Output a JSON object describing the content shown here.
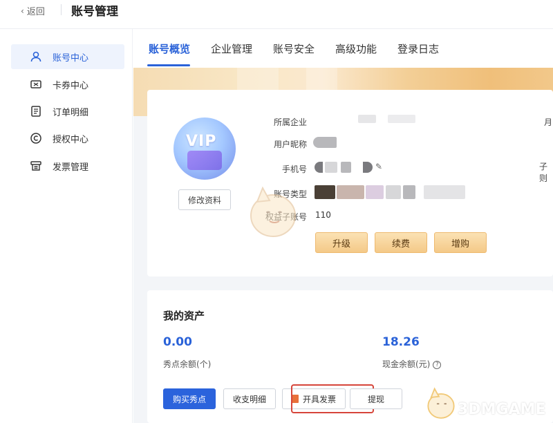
{
  "topbar": {
    "back_label": "返回",
    "title": "账号管理"
  },
  "sidebar": {
    "items": [
      {
        "label": "账号中心",
        "icon": "user-icon",
        "active": true
      },
      {
        "label": "卡券中心",
        "icon": "ticket-icon",
        "active": false
      },
      {
        "label": "订单明细",
        "icon": "document-icon",
        "active": false
      },
      {
        "label": "授权中心",
        "icon": "copyright-icon",
        "active": false
      },
      {
        "label": "发票管理",
        "icon": "invoice-icon",
        "active": false
      }
    ]
  },
  "tabs": [
    {
      "label": "账号概览",
      "active": true
    },
    {
      "label": "企业管理",
      "active": false
    },
    {
      "label": "账号安全",
      "active": false
    },
    {
      "label": "高级功能",
      "active": false
    },
    {
      "label": "登录日志",
      "active": false
    }
  ],
  "profile": {
    "badge_text": "VIP",
    "edit_label": "修改资料",
    "fields": {
      "company_label": "所属企业",
      "nickname_label": "用户昵称",
      "phone_label": "手机号",
      "account_type_label": "账号类型",
      "sub_accounts_label": "权益子账号",
      "sub_accounts_value": "110"
    },
    "right_cut_labels": [
      "月",
      "子则"
    ],
    "actions": {
      "upgrade": "升级",
      "renew": "续费",
      "add": "增购"
    }
  },
  "assets": {
    "title": "我的资产",
    "points_value": "0.00",
    "points_label": "秀点余额(个)",
    "cash_value": "18.26",
    "cash_label": "现金余额(元)",
    "buttons": {
      "buy_points": "购买秀点",
      "statement": "收支明细",
      "invoice": "开具发票",
      "withdraw": "提现"
    }
  },
  "watermark": {
    "text": "3DMGAME"
  },
  "colors": {
    "accent": "#2a62d8",
    "highlight_border": "#d6453a",
    "gold_button": "#f4c988"
  }
}
